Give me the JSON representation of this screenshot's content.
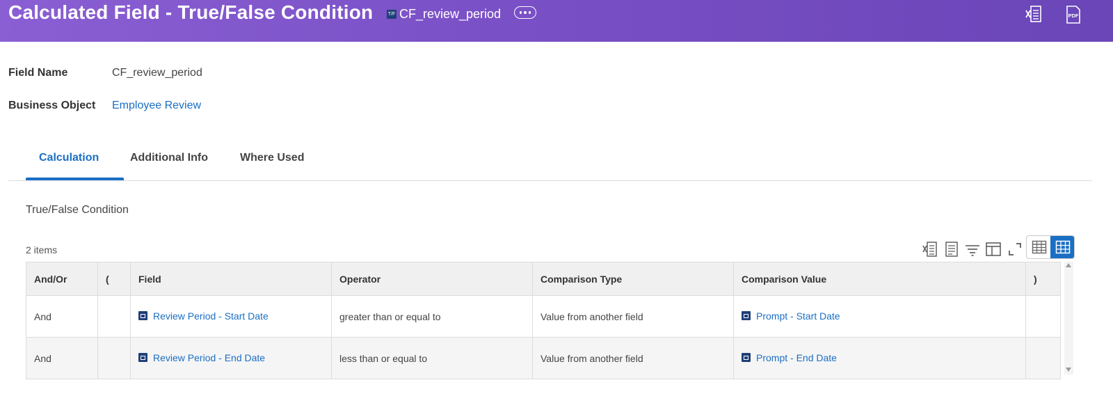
{
  "header": {
    "title": "Calculated Field - True/False Condition",
    "object_badge": "T/F",
    "object_name": "CF_review_period",
    "more_icon": "ellipsis-icon",
    "export_excel_icon": "excel-export-icon",
    "export_pdf_icon": "pdf-export-icon",
    "pdf_label": "PDF"
  },
  "fields": {
    "field_name_label": "Field Name",
    "field_name_value": "CF_review_period",
    "business_object_label": "Business Object",
    "business_object_value": "Employee Review"
  },
  "tabs": [
    {
      "label": "Calculation",
      "active": true
    },
    {
      "label": "Additional Info",
      "active": false
    },
    {
      "label": "Where Used",
      "active": false
    }
  ],
  "section_title": "True/False Condition",
  "grid": {
    "items_count": "2 items",
    "columns": [
      "And/Or",
      "(",
      "Field",
      "Operator",
      "Comparison Type",
      "Comparison Value",
      ")"
    ],
    "rows": [
      {
        "and_or": "And",
        "open_paren": "",
        "field": "Review Period - Start Date",
        "operator": "greater than or equal to",
        "comparison_type": "Value from another field",
        "comparison_value": "Prompt - Start Date",
        "close_paren": ""
      },
      {
        "and_or": "And",
        "open_paren": "",
        "field": "Review Period - End Date",
        "operator": "less than or equal to",
        "comparison_type": "Value from another field",
        "comparison_value": "Prompt - End Date",
        "close_paren": ""
      }
    ],
    "toolbar_icons": [
      "excel-export-icon",
      "print-icon",
      "filter-icon",
      "column-chooser-icon",
      "fullscreen-icon",
      "table-view-icon",
      "grid-view-icon"
    ]
  },
  "colors": {
    "header_gradient_start": "#8a5fd3",
    "header_gradient_end": "#6a46b8",
    "link": "#1a6fc4",
    "active_toggle": "#1a6fc4"
  }
}
